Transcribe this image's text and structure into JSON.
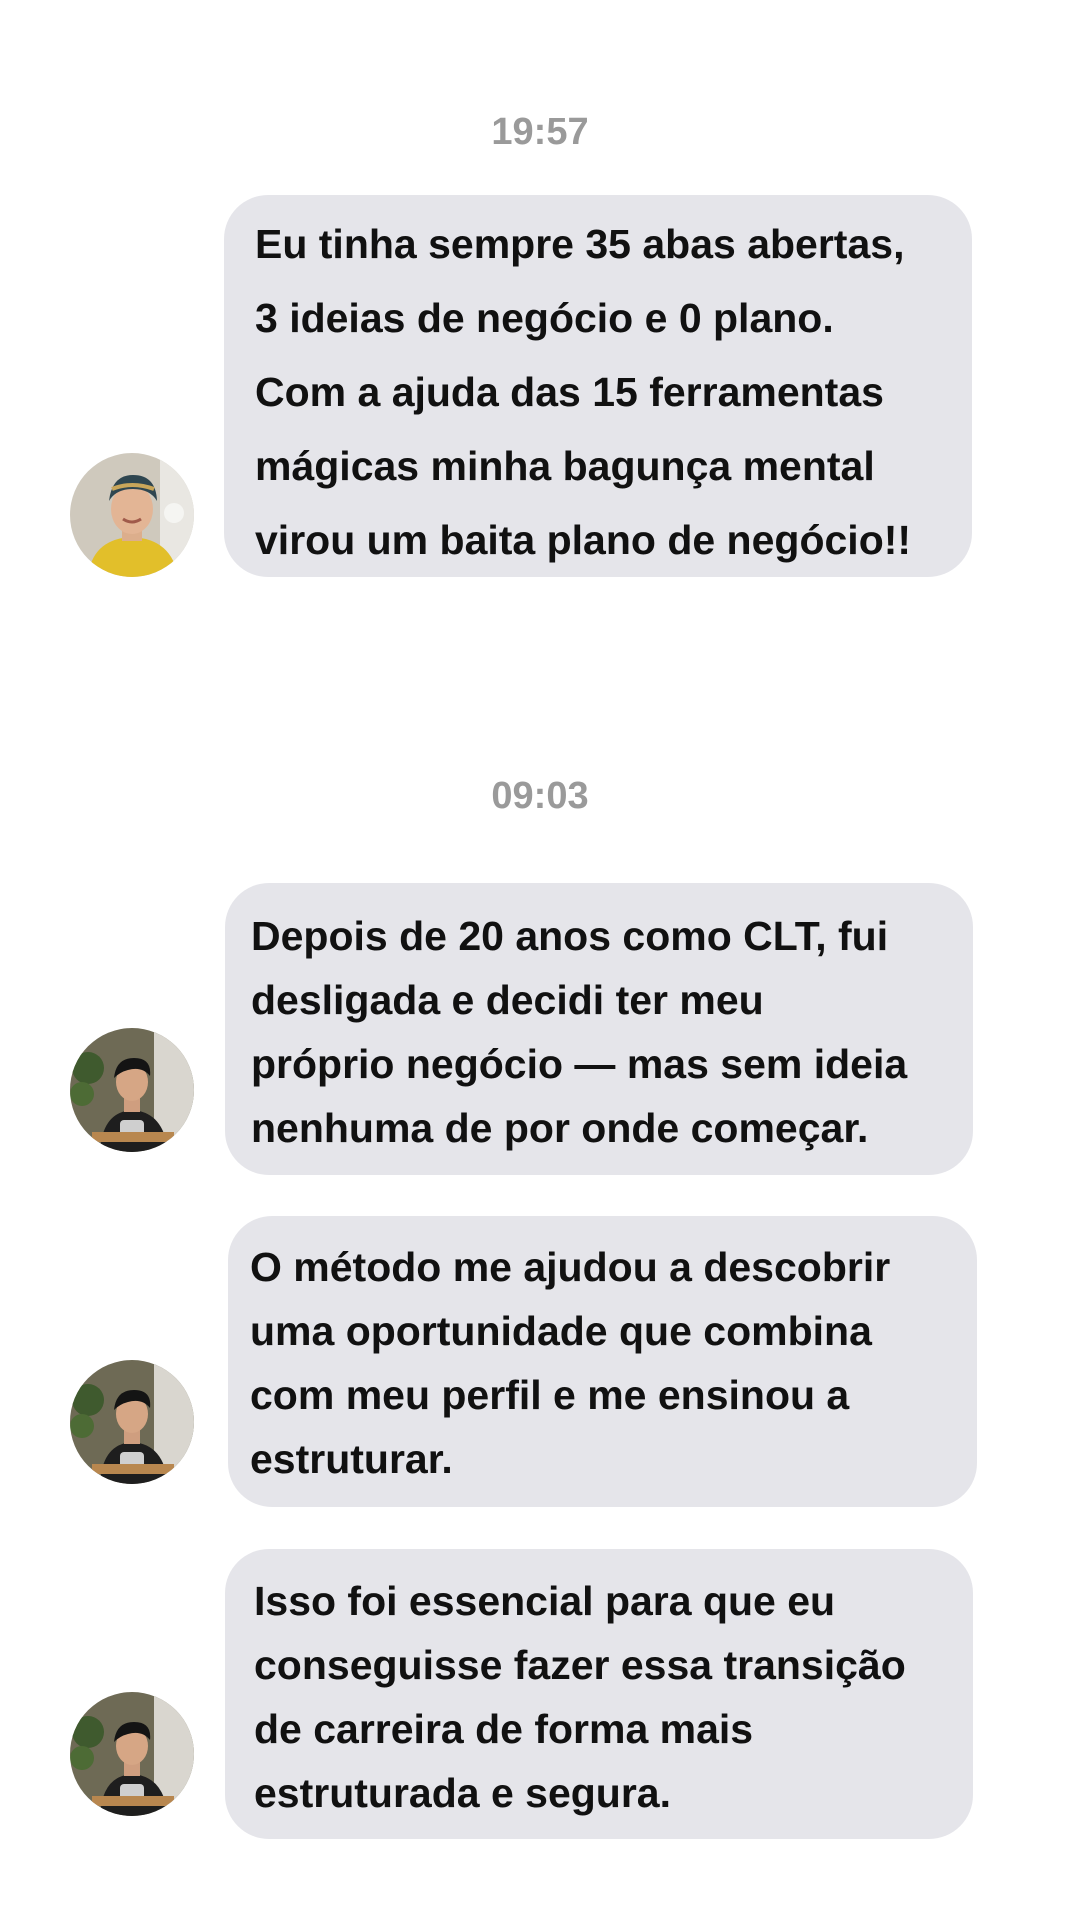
{
  "conversation": {
    "timestamps": [
      "19:57",
      "09:03"
    ],
    "messages": [
      {
        "text": "Eu tinha sempre 35 abas abertas,\n3 ideias de negócio e 0 plano.\nCom a ajuda das 15 ferramentas\nmágicas minha bagunça mental\nvirou um baita plano de negócio!!",
        "avatar": "woman-headscarf-avatar"
      },
      {
        "text": "Depois de 20 anos como CLT, fui\ndesligada e decidi ter meu\npróprio negócio — mas sem ideia\nnenhuma de por onde começar.",
        "avatar": "woman-short-hair-avatar"
      },
      {
        "text": "O método me ajudou a descobrir\numa oportunidade que combina\ncom meu perfil e me ensinou a\nestruturar.",
        "avatar": "woman-short-hair-avatar"
      },
      {
        "text": "Isso foi essencial para que eu\nconseguisse fazer essa transição\nde carreira de forma mais\nestruturada e segura.",
        "avatar": "woman-short-hair-avatar"
      }
    ]
  },
  "colors": {
    "bubble": "#e5e5ea",
    "timestamp": "#9a9a9a",
    "text": "#111111"
  }
}
